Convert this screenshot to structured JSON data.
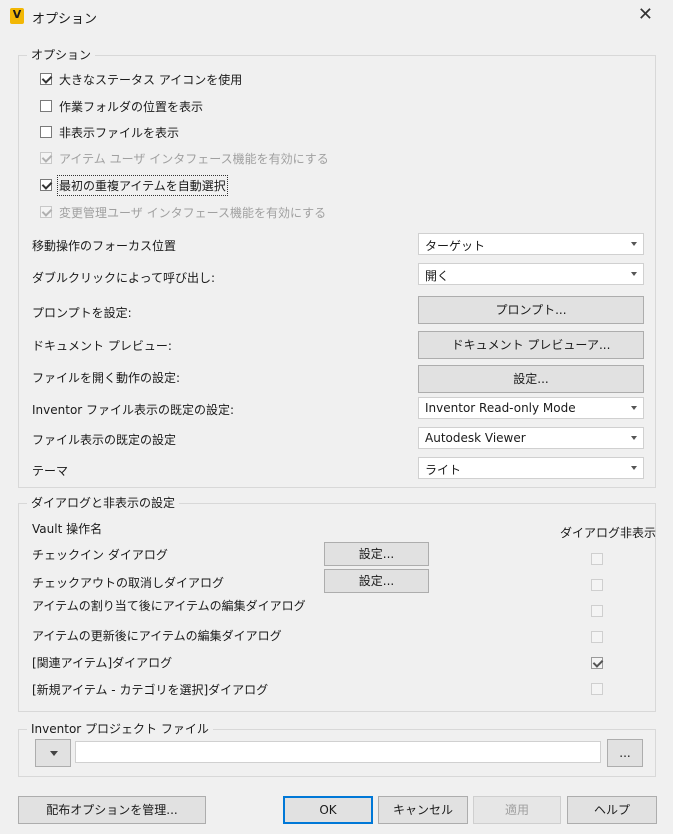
{
  "window": {
    "title": "オプション",
    "app_icon_letter": "V",
    "close_glyph": "✕"
  },
  "options_group": {
    "title": "オプション",
    "checkboxes": [
      {
        "label": "大きなステータス アイコンを使用",
        "checked": true,
        "enabled": true
      },
      {
        "label": "作業フォルダの位置を表示",
        "checked": false,
        "enabled": true
      },
      {
        "label": "非表示ファイルを表示",
        "checked": false,
        "enabled": true
      },
      {
        "label": "アイテム ユーザ インタフェース機能を有効にする",
        "checked": true,
        "enabled": false
      },
      {
        "label": "最初の重複アイテムを自動選択",
        "checked": true,
        "enabled": true
      },
      {
        "label": "変更管理ユーザ インタフェース機能を有効にする",
        "checked": true,
        "enabled": false
      }
    ],
    "settings": {
      "move_focus": {
        "label": "移動操作のフォーカス位置",
        "value": "ターゲット"
      },
      "double_click": {
        "label": "ダブルクリックによって呼び出し:",
        "value": "開く"
      },
      "prompt": {
        "label": "プロンプトを設定:",
        "button": "プロンプト..."
      },
      "doc_preview": {
        "label": "ドキュメント プレビュー:",
        "button": "ドキュメント プレビューア..."
      },
      "file_open": {
        "label": "ファイルを開く動作の設定:",
        "button": "設定..."
      },
      "inventor_default": {
        "label": "Inventor ファイル表示の既定の設定:",
        "value": "Inventor Read-only Mode"
      },
      "file_view_default": {
        "label": "ファイル表示の既定の設定",
        "value": "Autodesk Viewer"
      },
      "theme": {
        "label": "テーマ",
        "value": "ライト"
      }
    }
  },
  "dialogs_group": {
    "title": "ダイアログと非表示の設定",
    "col_operation": "Vault 操作名",
    "col_suppress": "ダイアログ非表示",
    "rows": [
      {
        "label": "チェックイン ダイアログ",
        "button": "設定...",
        "suppressed": false
      },
      {
        "label": "チェックアウトの取消しダイアログ",
        "button": "設定...",
        "suppressed": false
      },
      {
        "label": "アイテムの割り当て後にアイテムの編集ダイアログ",
        "suppressed": false
      },
      {
        "label": "アイテムの更新後にアイテムの編集ダイアログ",
        "suppressed": false
      },
      {
        "label": "[関連アイテム]ダイアログ",
        "suppressed": true
      },
      {
        "label": "[新規アイテム - カテゴリを選択]ダイアログ",
        "suppressed": false
      }
    ]
  },
  "project_group": {
    "title": "Inventor プロジェクト ファイル",
    "path_value": "",
    "browse_label": "..."
  },
  "footer": {
    "manage_label": "配布オプションを管理...",
    "ok_label": "OK",
    "cancel_label": "キャンセル",
    "apply_label": "適用",
    "help_label": "ヘルプ"
  },
  "colors": {
    "background": "#f0f0f0",
    "default_button_border": "#0078d7",
    "icon_accent": "#f2b705"
  }
}
